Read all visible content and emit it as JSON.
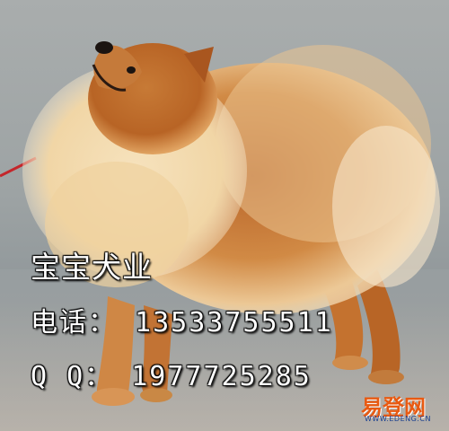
{
  "overlay": {
    "brand": "宝宝犬业",
    "phone_line": "电话： 13533755511",
    "qq_line": "Q  Q： 1977725285"
  },
  "watermark": {
    "main": "易登网",
    "sub": "WWW.EDENG.CN"
  },
  "colors": {
    "fur_base": "#c9752e",
    "fur_light": "#f2d7a6",
    "fur_dark": "#8a4a1c",
    "ground": "#9aa0a2",
    "watermark_orange": "#e85a12",
    "watermark_blue": "#1a3f8f"
  }
}
